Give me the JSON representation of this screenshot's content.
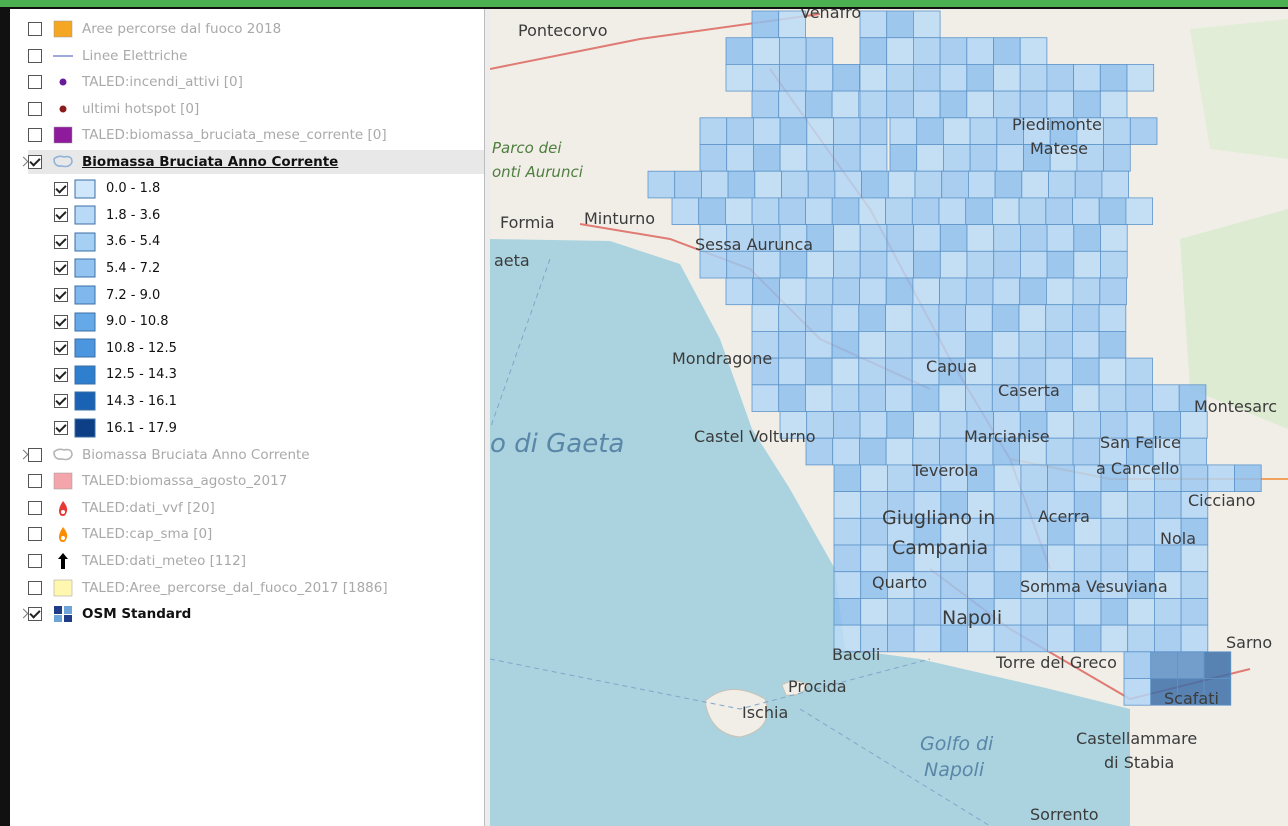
{
  "layers": {
    "items": [
      {
        "label": "Aree percorse dal fuoco 2018",
        "checked": false,
        "state": "inactive",
        "icon": "orange-square-icon",
        "color": "#f5a623"
      },
      {
        "label": "Linee Elettriche",
        "checked": false,
        "state": "inactive",
        "icon": "line-icon",
        "color": "#9fa8da"
      },
      {
        "label": "TALED:incendi_attivi [0]",
        "checked": false,
        "state": "inactive",
        "icon": "purple-dot-icon",
        "color": "#6a1b9a"
      },
      {
        "label": "ultimi hotspot [0]",
        "checked": false,
        "state": "inactive",
        "icon": "red-dot-icon",
        "color": "#8b1a1a"
      },
      {
        "label": "TALED:biomassa_bruciata_mese_corrente [0]",
        "checked": false,
        "state": "inactive",
        "icon": "purple-square-icon",
        "color": "#8e1b9c"
      },
      {
        "label": "Biomassa Bruciata Anno Corrente",
        "checked": true,
        "state": "selected",
        "icon": "polygon-icon",
        "color": "#90b4d8"
      }
    ],
    "classes": [
      {
        "label": "0.0 - 1.8",
        "checked": true,
        "color": "#cfe6fb"
      },
      {
        "label": "1.8 - 3.6",
        "checked": true,
        "color": "#b9daf7"
      },
      {
        "label": "3.6 - 5.4",
        "checked": true,
        "color": "#a6cff4"
      },
      {
        "label": "5.4 - 7.2",
        "checked": true,
        "color": "#93c4f1"
      },
      {
        "label": "7.2 - 9.0",
        "checked": true,
        "color": "#7fb8ed"
      },
      {
        "label": "9.0 - 10.8",
        "checked": true,
        "color": "#66a9e8"
      },
      {
        "label": "10.8 - 12.5",
        "checked": true,
        "color": "#4b96de"
      },
      {
        "label": "12.5 - 14.3",
        "checked": true,
        "color": "#2f7fcf"
      },
      {
        "label": "14.3 - 16.1",
        "checked": true,
        "color": "#1a62b3"
      },
      {
        "label": "16.1 - 17.9",
        "checked": true,
        "color": "#0c3f86"
      }
    ],
    "items_after": [
      {
        "label": "Biomassa Bruciata Anno Corrente",
        "checked": false,
        "state": "inactive",
        "icon": "polygon-icon",
        "color": "#b5b5b5"
      },
      {
        "label": "TALED:biomassa_agosto_2017",
        "checked": false,
        "state": "inactive",
        "icon": "pink-square-icon",
        "color": "#f4a5ab"
      },
      {
        "label": "TALED:dati_vvf [20]",
        "checked": false,
        "state": "inactive",
        "icon": "fire-red-icon",
        "color": "#e53935"
      },
      {
        "label": "TALED:cap_sma [0]",
        "checked": false,
        "state": "inactive",
        "icon": "fire-orange-icon",
        "color": "#fb8c00"
      },
      {
        "label": "TALED:dati_meteo [112]",
        "checked": false,
        "state": "inactive",
        "icon": "arrow-up-icon",
        "color": "#000000"
      },
      {
        "label": "TALED:Aree_percorse_dal_fuoco_2017 [1886]",
        "checked": false,
        "state": "inactive",
        "icon": "yellow-square-icon",
        "color": "#fff7b0"
      },
      {
        "label": "OSM Standard",
        "checked": true,
        "state": "active",
        "icon": "osm-tiles-icon",
        "color": "#1f3c88"
      }
    ]
  },
  "map": {
    "places": [
      "Pontecorvo",
      "Piedimonte",
      "Matese",
      "Parco dei",
      "onti Aurunci",
      "Formia",
      "Minturno",
      "Sessa Aurunca",
      "aeta",
      "Mondragone",
      "Capua",
      "Caserta",
      "Montesarc",
      "Castel Volturno",
      "Marcianise",
      "San Felice",
      "a Cancello",
      "Teverola",
      "Cicciano",
      "Giugliano in",
      "Acerra",
      "Campania",
      "Nola",
      "Quarto",
      "Somma Vesuviana",
      "Napoli",
      "Bacoli",
      "Sarno",
      "Torre del Greco",
      "Procida",
      "Scafati",
      "Ischia",
      "Castellammare",
      "di Stabia",
      "Sorrento",
      "Venafro"
    ],
    "seas": [
      "o di Gaeta",
      "Golfo di",
      "Napoli"
    ]
  }
}
